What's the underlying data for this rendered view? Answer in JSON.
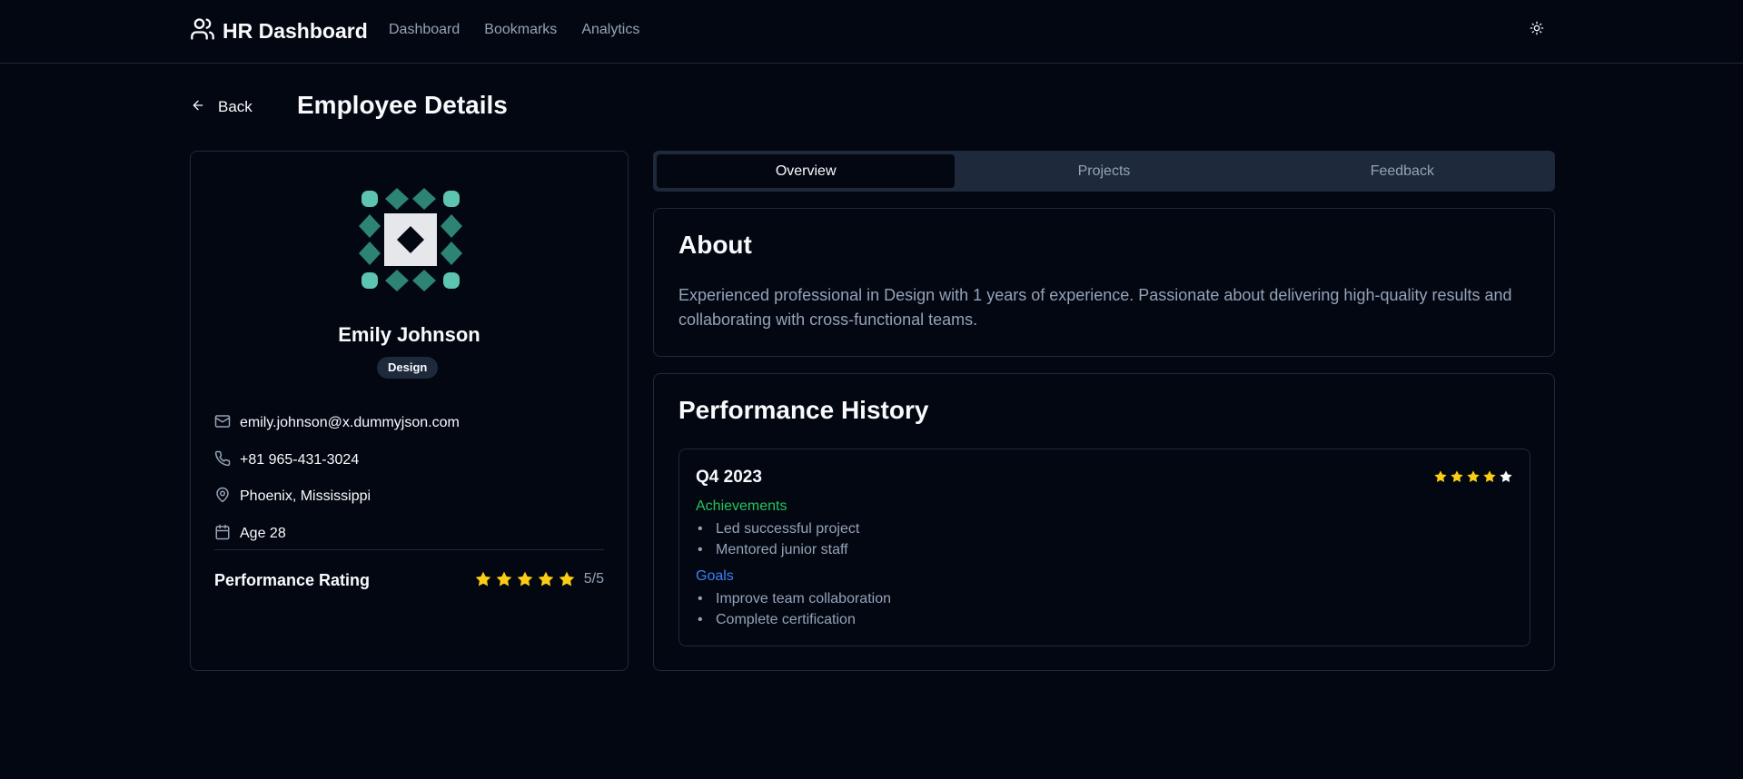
{
  "header": {
    "brand": "HR Dashboard",
    "nav": [
      "Dashboard",
      "Bookmarks",
      "Analytics"
    ],
    "theme_icon": "sun-icon"
  },
  "page": {
    "back_label": "Back",
    "title": "Employee Details"
  },
  "profile": {
    "name": "Emily Johnson",
    "department": "Design",
    "email": "emily.johnson@x.dummyjson.com",
    "phone": "+81 965-431-3024",
    "location": "Phoenix, Mississippi",
    "age": "Age 28",
    "rating_label": "Performance Rating",
    "rating_value": "5/5",
    "rating": 5,
    "rating_max": 5
  },
  "tabs": [
    "Overview",
    "Projects",
    "Feedback"
  ],
  "active_tab": "Overview",
  "about": {
    "title": "About",
    "text": "Experienced professional in Design with 1 years of experience. Passionate about delivering high-quality results and collaborating with cross-functional teams."
  },
  "performance": {
    "title": "Performance History",
    "reviews": [
      {
        "quarter": "Q4 2023",
        "rating": 4,
        "rating_max": 5,
        "achievements_label": "Achievements",
        "achievements": [
          "Led successful project",
          "Mentored junior staff"
        ],
        "goals_label": "Goals",
        "goals": [
          "Improve team collaboration",
          "Complete certification"
        ]
      }
    ]
  },
  "colors": {
    "background": "#030711",
    "border": "#1e293b",
    "star": "#facc15",
    "achievements": "#22c55e",
    "goals": "#3b82f6",
    "muted": "#94a3b8",
    "avatar_teal": "#2d8374",
    "avatar_mint": "#5cc4b0"
  }
}
